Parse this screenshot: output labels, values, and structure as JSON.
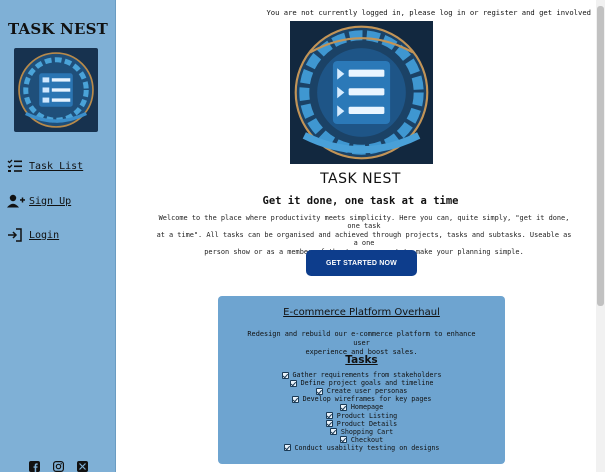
{
  "sidebar": {
    "brand": "TASK NEST",
    "logo_icon": "task-nest-logo",
    "nav": [
      {
        "label": "Task List",
        "icon": "task-list-icon"
      },
      {
        "label": "Sign Up",
        "icon": "user-plus-icon"
      },
      {
        "label": "Login",
        "icon": "login-arrow-icon"
      }
    ],
    "socials": [
      "facebook-icon",
      "instagram-icon",
      "x-twitter-icon"
    ]
  },
  "header": {
    "auth_notice": "You are not currently logged in, please log in or register and get involved"
  },
  "hero": {
    "title": "TASK NEST",
    "tagline": "Get it done, one task at a time",
    "intro_lines": [
      "Welcome to the place where productivity meets simplicity. Here you can, quite simply, \"get it done, one task",
      "at a time\". All tasks can be organised and achieved through projects, tasks and subtasks. Useable as a one",
      "person show or as a member of the team, we want to make your planning simple."
    ],
    "cta_label": "GET STARTED NOW"
  },
  "project": {
    "title": "E-commerce Platform Overhaul",
    "description_lines": [
      "Redesign and rebuild our e-commerce platform to enhance user",
      "experience and boost sales."
    ],
    "tasks_heading": "Tasks",
    "tasks": [
      "Gather requirements from stakeholders",
      "Define project goals and timeline",
      "Create user personas",
      "Develop wireframes for key pages",
      "Homepage",
      "Product Listing",
      "Product Details",
      "Shopping Cart",
      "Checkout",
      "Conduct usability testing on designs"
    ]
  },
  "colors": {
    "sidebar_bg": "#7fb0d6",
    "card_bg": "#6ea4d0",
    "cta_bg": "#0d3d8c",
    "logo_bg": "#1a3b5c"
  }
}
